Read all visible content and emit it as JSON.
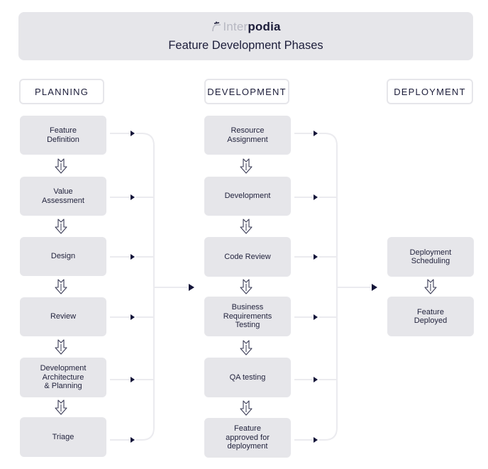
{
  "header": {
    "logo_light": "Inter",
    "logo_bold": "podia",
    "logo_icon": "interpodia-logo-icon",
    "title": "Feature Development Phases"
  },
  "phases": [
    {
      "label": "PLANNING"
    },
    {
      "label": "DEVELOPMENT"
    },
    {
      "label": "DEPLOYMENT"
    }
  ],
  "planning": {
    "steps": [
      "Feature\nDefinition",
      "Value\nAssessment",
      "Design",
      "Review",
      "Development\nArchitecture\n& Planning",
      "Triage"
    ]
  },
  "development": {
    "steps": [
      "Resource\nAssignment",
      "Development",
      "Code Review",
      "Business\nRequirements\nTesting",
      "QA testing",
      "Feature\napproved for\ndeployment"
    ]
  },
  "deployment": {
    "steps": [
      "Deployment\nScheduling",
      "Feature\nDeployed"
    ]
  },
  "colors": {
    "box": "#e6e6ea",
    "text": "#1c1d3a",
    "connector": "#ebebef",
    "arrow": "#14153a"
  }
}
